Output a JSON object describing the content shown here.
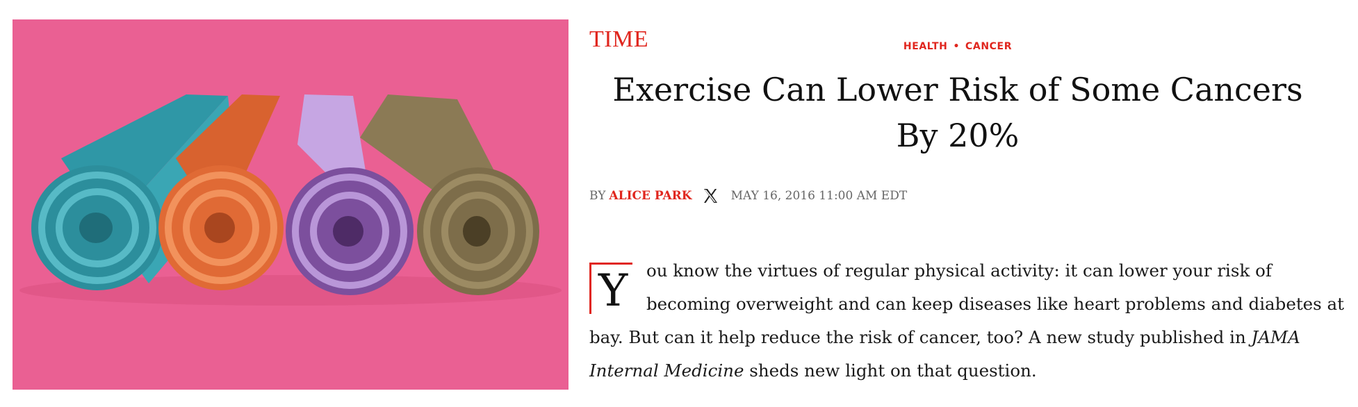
{
  "hero_image": {
    "alt": "Four rolled yoga mats on a pink background",
    "colors": {
      "background": "#ea6093",
      "mat_teal": "#3aa6b4",
      "mat_orange": "#e8713f",
      "mat_lilac": "#b795d6",
      "mat_olive": "#8b7a55"
    }
  },
  "brand": {
    "logo_text": "TIME",
    "color": "#e0261e"
  },
  "section": {
    "primary": "HEALTH",
    "separator": "•",
    "secondary": "CANCER"
  },
  "headline": "Exercise Can Lower Risk of Some Cancers By 20%",
  "byline": {
    "prefix": "BY",
    "author": "ALICE PARK",
    "social_icon": "x-icon",
    "date": "MAY 16, 2016 11:00 AM EDT"
  },
  "article": {
    "dropcap": "Y",
    "lead_text": "ou know the virtues of regular physical activity: it can lower your risk of becoming overweight and can keep diseases like heart problems and diabetes at bay. But can it help reduce the risk of cancer, too? A new study published in ",
    "publication": "JAMA Internal Medicine",
    "tail_text": " sheds new light on that question."
  }
}
